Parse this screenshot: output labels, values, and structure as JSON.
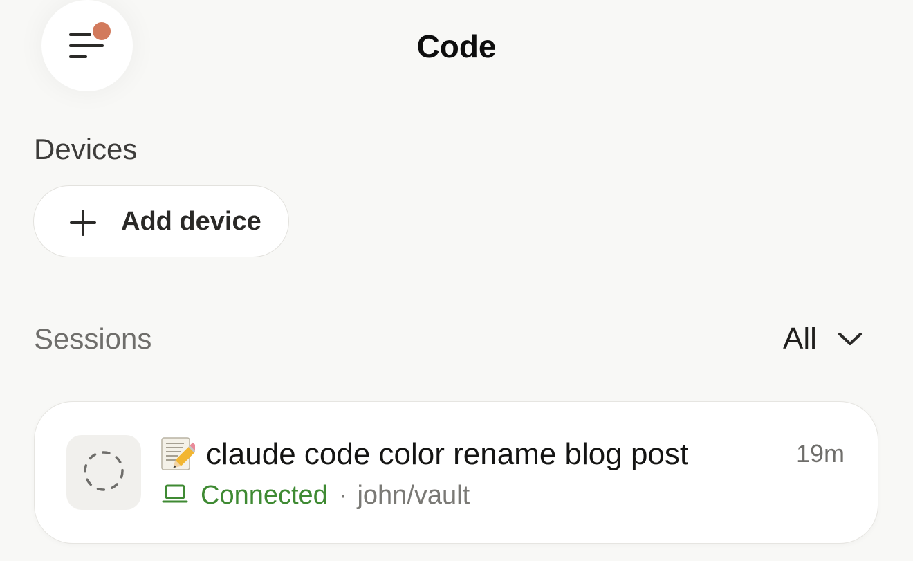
{
  "header": {
    "title": "Code",
    "menu_icon": "menu-icon",
    "notification_color": "#d27a5c"
  },
  "devices": {
    "label": "Devices",
    "add_button_label": "Add device"
  },
  "sessions": {
    "label": "Sessions",
    "filter": {
      "selected": "All"
    },
    "items": [
      {
        "emoji": "memo-icon",
        "title": "claude code color rename blog post",
        "time": "19m",
        "status": "Connected",
        "status_color": "#3f8a33",
        "separator": "·",
        "repo": "john/vault"
      }
    ]
  }
}
